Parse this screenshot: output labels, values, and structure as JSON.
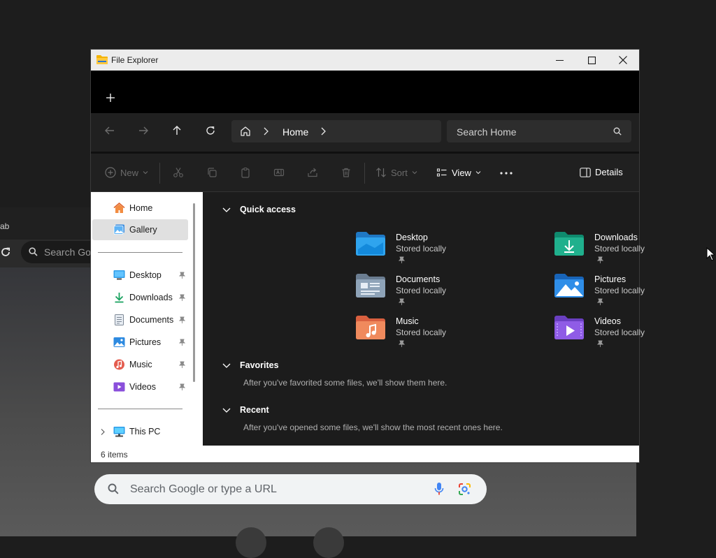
{
  "background_browser": {
    "tab_label_fragment": "ab",
    "omnibox_placeholder": "Search Goo",
    "google_search_placeholder": "Search Google or type a URL"
  },
  "window": {
    "title": "File Explorer",
    "controls": [
      "minimize",
      "maximize",
      "close"
    ]
  },
  "tabs": {
    "new_tab_icon": "plus-icon"
  },
  "navbar": {
    "breadcrumb": [
      "Home"
    ],
    "search_placeholder": "Search Home"
  },
  "commandbar": {
    "new_label": "New",
    "sort_label": "Sort",
    "view_label": "View",
    "details_label": "Details"
  },
  "navpane": {
    "top_items": [
      {
        "label": "Home",
        "icon": "home-icon",
        "selected": false
      },
      {
        "label": "Gallery",
        "icon": "gallery-icon",
        "selected": true
      }
    ],
    "pinned_items": [
      {
        "label": "Desktop",
        "icon": "desktop-icon"
      },
      {
        "label": "Downloads",
        "icon": "downloads-icon"
      },
      {
        "label": "Documents",
        "icon": "documents-icon"
      },
      {
        "label": "Pictures",
        "icon": "pictures-icon"
      },
      {
        "label": "Music",
        "icon": "music-icon"
      },
      {
        "label": "Videos",
        "icon": "videos-icon"
      }
    ],
    "pc_item": {
      "label": "This PC",
      "icon": "this-pc-icon"
    }
  },
  "content": {
    "quick_access": {
      "title": "Quick access",
      "items": [
        {
          "name": "Desktop",
          "subtitle": "Stored locally",
          "icon": "desktop-folder-icon"
        },
        {
          "name": "Downloads",
          "subtitle": "Stored locally",
          "icon": "downloads-folder-icon"
        },
        {
          "name": "Documents",
          "subtitle": "Stored locally",
          "icon": "documents-folder-icon"
        },
        {
          "name": "Pictures",
          "subtitle": "Stored locally",
          "icon": "pictures-folder-icon"
        },
        {
          "name": "Music",
          "subtitle": "Stored locally",
          "icon": "music-folder-icon"
        },
        {
          "name": "Videos",
          "subtitle": "Stored locally",
          "icon": "videos-folder-icon"
        }
      ]
    },
    "favorites": {
      "title": "Favorites",
      "message": "After you've favorited some files, we'll show them here."
    },
    "recent": {
      "title": "Recent",
      "message": "After you've opened some files, we'll show the most recent ones here."
    }
  },
  "status": {
    "items_count": "6 items"
  }
}
